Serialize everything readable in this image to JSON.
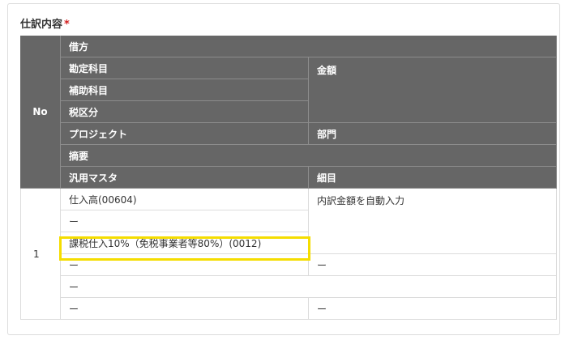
{
  "section": {
    "title": "仕訳内容",
    "required_mark": "*"
  },
  "table": {
    "header": {
      "no": "No",
      "debit": "借方",
      "account": "勘定科目",
      "amount": "金額",
      "sub_account": "補助科目",
      "tax_category": "税区分",
      "project": "プロジェクト",
      "department": "部門",
      "description": "摘要",
      "general_master": "汎用マスタ",
      "detail": "細目"
    },
    "rows": [
      {
        "no": "1",
        "account": "仕入高(00604)",
        "amount": "内訳金額を自動入力",
        "sub_account": "ー",
        "tax_category": "課税仕入10%（免税事業者等80%）(0012)",
        "project": "ー",
        "department": "ー",
        "description": "ー",
        "general_master": "ー",
        "detail": "ー"
      }
    ]
  },
  "highlight_color": "#f5dd00"
}
